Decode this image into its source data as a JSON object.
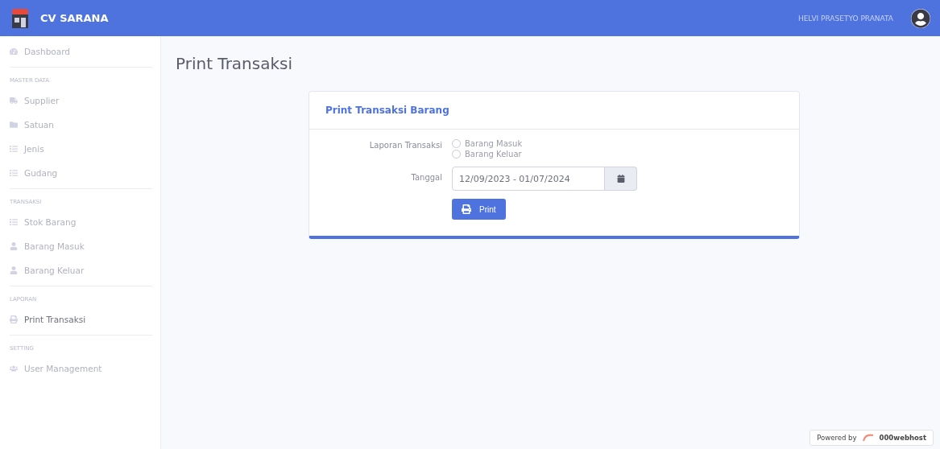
{
  "header": {
    "brand": "CV SARANA",
    "user": "HELVI PRASETYO PRANATA"
  },
  "sidebar": {
    "sections": [
      {
        "items": [
          {
            "label": "Dashboard",
            "kind": "dashboard",
            "selected": false
          }
        ]
      },
      {
        "heading": "MASTER DATA",
        "items": [
          {
            "label": "Supplier",
            "kind": "truck",
            "selected": false
          },
          {
            "label": "Satuan",
            "kind": "folder",
            "selected": false
          },
          {
            "label": "Jenis",
            "kind": "list",
            "selected": false
          },
          {
            "label": "Gudang",
            "kind": "list",
            "selected": false
          }
        ]
      },
      {
        "heading": "TRANSAKSI",
        "items": [
          {
            "label": "Stok Barang",
            "kind": "list",
            "selected": false
          },
          {
            "label": "Barang Masuk",
            "kind": "user",
            "selected": false
          },
          {
            "label": "Barang Keluar",
            "kind": "user",
            "selected": false
          }
        ]
      },
      {
        "heading": "LAPORAN",
        "items": [
          {
            "label": "Print Transaksi",
            "kind": "print",
            "selected": true
          }
        ]
      },
      {
        "heading": "SETTING",
        "items": [
          {
            "label": "User Management",
            "kind": "users",
            "selected": false
          }
        ]
      }
    ]
  },
  "page": {
    "title": "Print Transaksi"
  },
  "card": {
    "title": "Print Transaksi Barang",
    "report_label": "Laporan Transaksi",
    "options": [
      {
        "label": "Barang Masuk",
        "selected": false
      },
      {
        "label": "Barang Keluar",
        "selected": false
      }
    ],
    "date_label": "Tanggal",
    "date_value": "12/09/2023 - 01/07/2024",
    "button": "Print"
  },
  "badge": {
    "prefix": "Powered by",
    "brand": "000webhost"
  }
}
